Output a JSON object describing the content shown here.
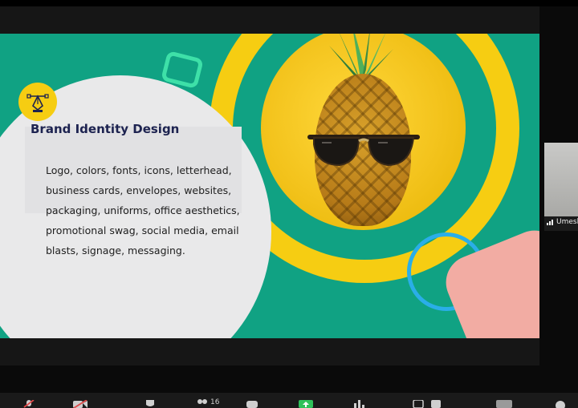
{
  "slide": {
    "title": "Brand Identity Design",
    "body": "Logo, colors, fonts, icons, letterhead, business cards, envelopes, websites, packaging, uniforms, office aesthetics, promotional swag, social media, email blasts, signage, messaging.",
    "logo_icon": "pen-tool-icon"
  },
  "participant": {
    "name": "Umesh"
  },
  "toolbar": {
    "participants_count": "16"
  },
  "colors": {
    "slide_green": "#10a283",
    "ring_yellow": "#f6cd12",
    "panel_gray": "#e9e9ea",
    "title_navy": "#1d2350",
    "accent_blue": "#2aaee8",
    "accent_pink": "#f2aca3",
    "accent_mint": "#3ee0a8"
  }
}
